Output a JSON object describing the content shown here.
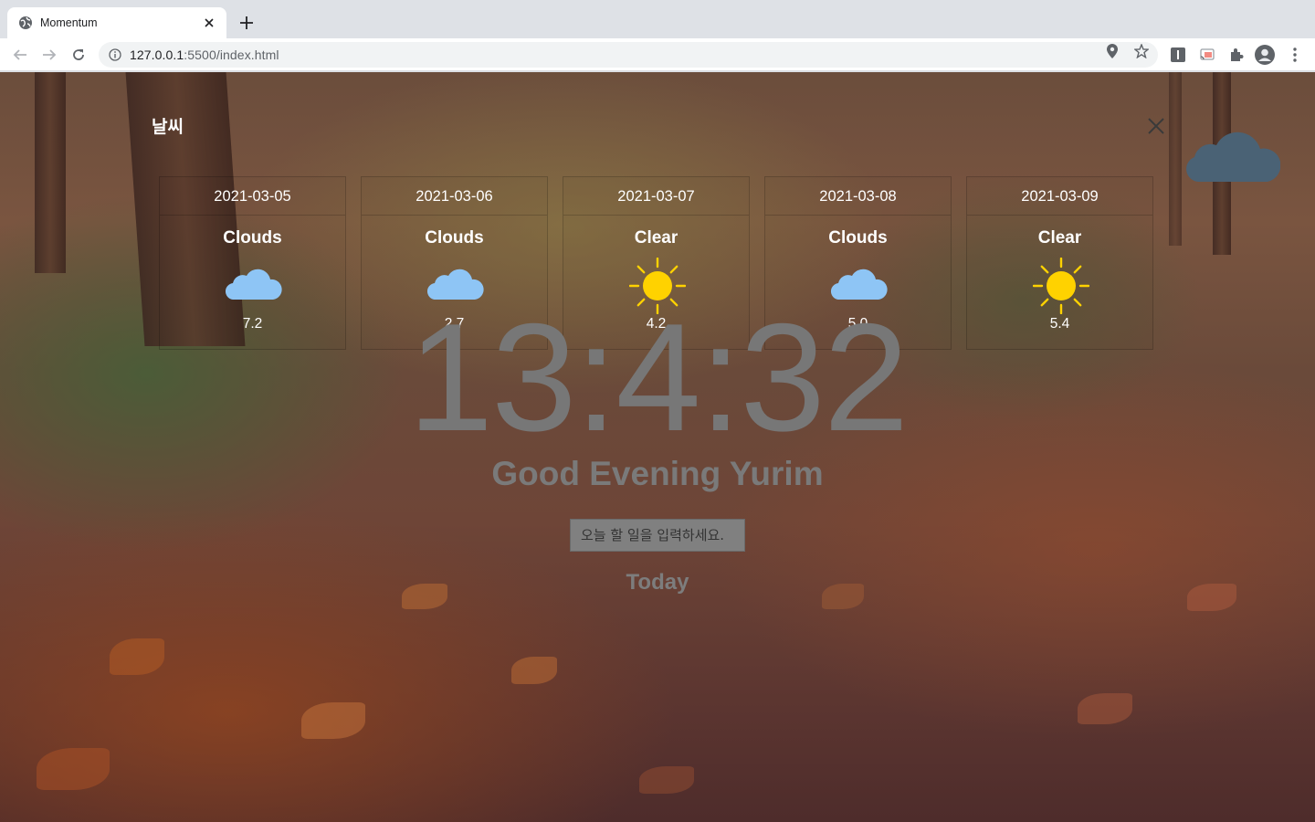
{
  "browser": {
    "tab_title": "Momentum",
    "url_host": "127.0.0.1",
    "url_rest": ":5500/index.html"
  },
  "weather": {
    "title": "날씨",
    "days": [
      {
        "date": "2021-03-05",
        "main": "Clouds",
        "temp": "7.2",
        "icon": "cloud-icon"
      },
      {
        "date": "2021-03-06",
        "main": "Clouds",
        "temp": "2.7",
        "icon": "cloud-icon"
      },
      {
        "date": "2021-03-07",
        "main": "Clear",
        "temp": "4.2",
        "icon": "sun-icon"
      },
      {
        "date": "2021-03-08",
        "main": "Clouds",
        "temp": "5.0",
        "icon": "cloud-icon"
      },
      {
        "date": "2021-03-09",
        "main": "Clear",
        "temp": "5.4",
        "icon": "sun-icon"
      }
    ]
  },
  "clock": "13:4:32",
  "greeting": "Good Evening Yurim",
  "todo": {
    "placeholder": "오늘 할 일을 입력하세요."
  },
  "today_label": "Today",
  "colors": {
    "cloud": "#8ec5f5",
    "sun": "#ffd200",
    "toggle_cloud": "#4a6275"
  }
}
